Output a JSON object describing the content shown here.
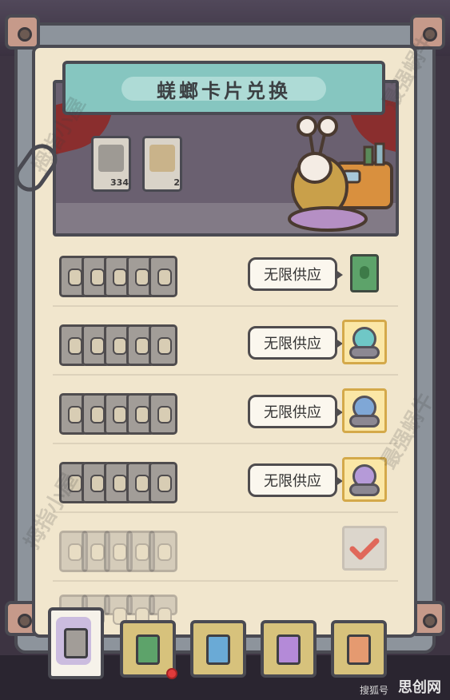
{
  "header": {
    "title": "蜣螂卡片兑换"
  },
  "resources": [
    {
      "name": "beetle-card",
      "count": "334"
    },
    {
      "name": "rock-card",
      "count": "2"
    }
  ],
  "rows": [
    {
      "label": "无限供应",
      "reward": "green-card",
      "supply_shown": true
    },
    {
      "label": "无限供应",
      "reward": "teal-badge",
      "supply_shown": true
    },
    {
      "label": "无限供应",
      "reward": "blue-badge",
      "supply_shown": true
    },
    {
      "label": "无限供应",
      "reward": "purple-badge",
      "supply_shown": true
    },
    {
      "label": "",
      "reward": "checked",
      "supply_shown": false
    }
  ],
  "tabs": [
    {
      "name": "tab-grey-beetle",
      "color": "#a29d98",
      "selected": true
    },
    {
      "name": "tab-green-beetle",
      "color": "#5da36a",
      "selected": false
    },
    {
      "name": "tab-blue-beetle",
      "color": "#6aaad6",
      "selected": false
    },
    {
      "name": "tab-purple-beetle",
      "color": "#b48ad8",
      "selected": false
    },
    {
      "name": "tab-orange-beetle",
      "color": "#e59a70",
      "selected": false
    }
  ],
  "watermarks": {
    "mark1": "最强蜗牛",
    "mark2": "拇指小屋"
  },
  "footer": {
    "text": "搜狐号",
    "logo": "思创网"
  },
  "colors": {
    "panel": "#f1e6cd",
    "banner": "#86c6c0",
    "frame": "#8d949c",
    "notification": "#e03b3b"
  }
}
